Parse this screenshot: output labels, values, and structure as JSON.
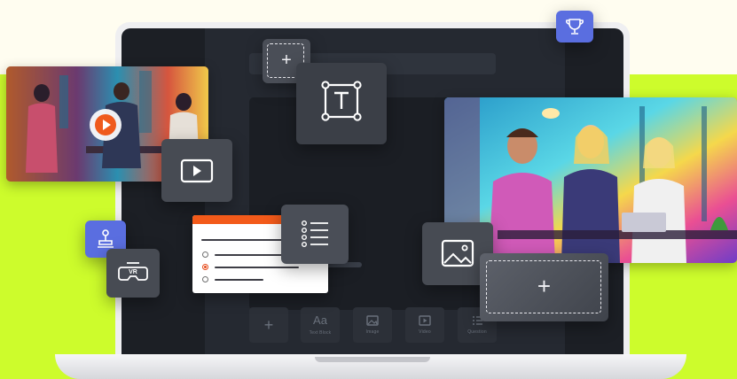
{
  "toolbar": {
    "add_glyph": "+",
    "text_block": {
      "icon": "text-aa-icon",
      "glyph": "Aa",
      "label": "Text Block"
    },
    "image": {
      "icon": "image-icon",
      "label": "Image"
    },
    "video": {
      "icon": "video-icon",
      "label": "Video"
    },
    "question": {
      "icon": "list-icon",
      "label": "Question"
    }
  },
  "floating": {
    "add_glyph_small": "+",
    "add_glyph_large": "+",
    "vr_label": "VR"
  },
  "colors": {
    "lime": "#cdfc2c",
    "screen": "#1c1f25",
    "accent_orange": "#f35a1a",
    "badge_blue": "#5a6ee0"
  }
}
